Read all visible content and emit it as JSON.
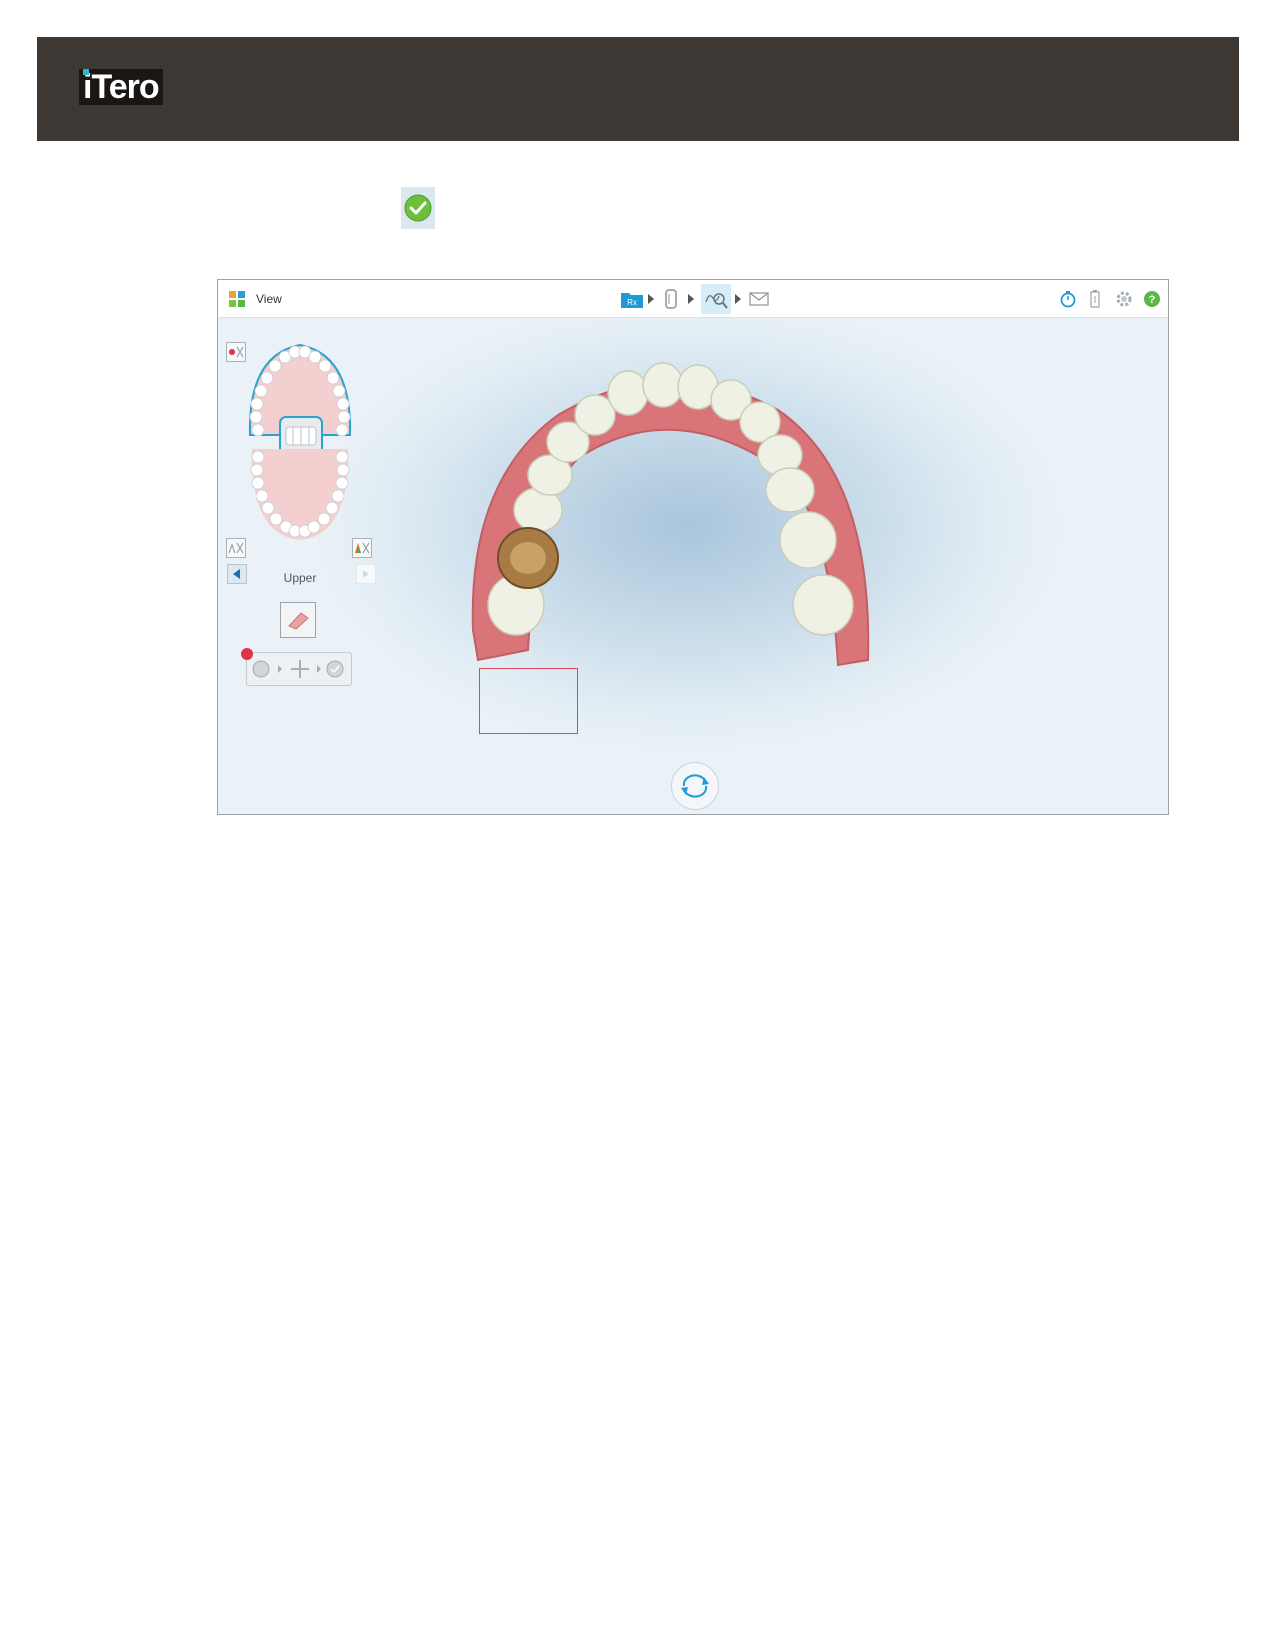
{
  "header": {
    "logo_text": "iTero"
  },
  "toolbar": {
    "view_label": "View",
    "step_rx_badge": "Rx"
  },
  "panel": {
    "arch_label": "Upper"
  },
  "icons": {
    "status": "check-circle-icon",
    "view_mode": "grid-icon",
    "rotate": "rotate-icon"
  },
  "colors": {
    "header_bg": "#3d3834",
    "accent_teal": "#2ab7c9",
    "success_green": "#6dbf3e",
    "selection_red": "#d8495a",
    "help_green": "#58b947",
    "active_blue": "#1e9bd7"
  }
}
